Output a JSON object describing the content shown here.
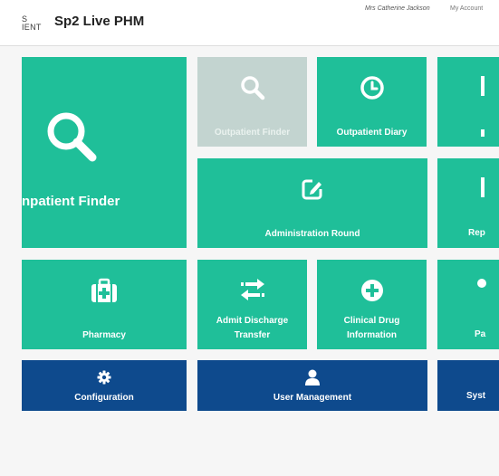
{
  "header": {
    "brand_line1": "S",
    "brand_line2": "IENT",
    "app_title": "Sp2 Live PHM",
    "user_name": "Mrs Catherine Jackson",
    "account_link": "My Account"
  },
  "tiles": {
    "inpatient_finder": "npatient Finder",
    "outpatient_finder": "Outpatient Finder",
    "outpatient_diary": "Outpatient Diary",
    "administration_round": "Administration Round",
    "pharmacy": "Pharmacy",
    "admit_discharge_line1": "Admit Discharge",
    "admit_discharge_line2": "Transfer",
    "clinical_drug_line1": "Clinical Drug",
    "clinical_drug_line2": "Information",
    "configuration": "Configuration",
    "user_management": "User Management",
    "right_col_row2": "Rep",
    "right_col_row3": "Pa",
    "right_col_row4": "Syst"
  },
  "colors": {
    "tile_green": "#1fbf99",
    "tile_disabled": "#c3d4d0",
    "tile_blue": "#0e4a8d",
    "page_bg": "#f6f6f6"
  },
  "icons": {
    "inpatient_finder": "search-icon",
    "outpatient_finder": "search-icon",
    "outpatient_diary": "clock-icon",
    "administration_round": "edit-icon",
    "pharmacy": "medical-kit-icon",
    "admit_discharge": "transfer-arrows-icon",
    "clinical_drug": "plus-circle-icon",
    "configuration": "gear-icon",
    "user_management": "user-icon"
  }
}
